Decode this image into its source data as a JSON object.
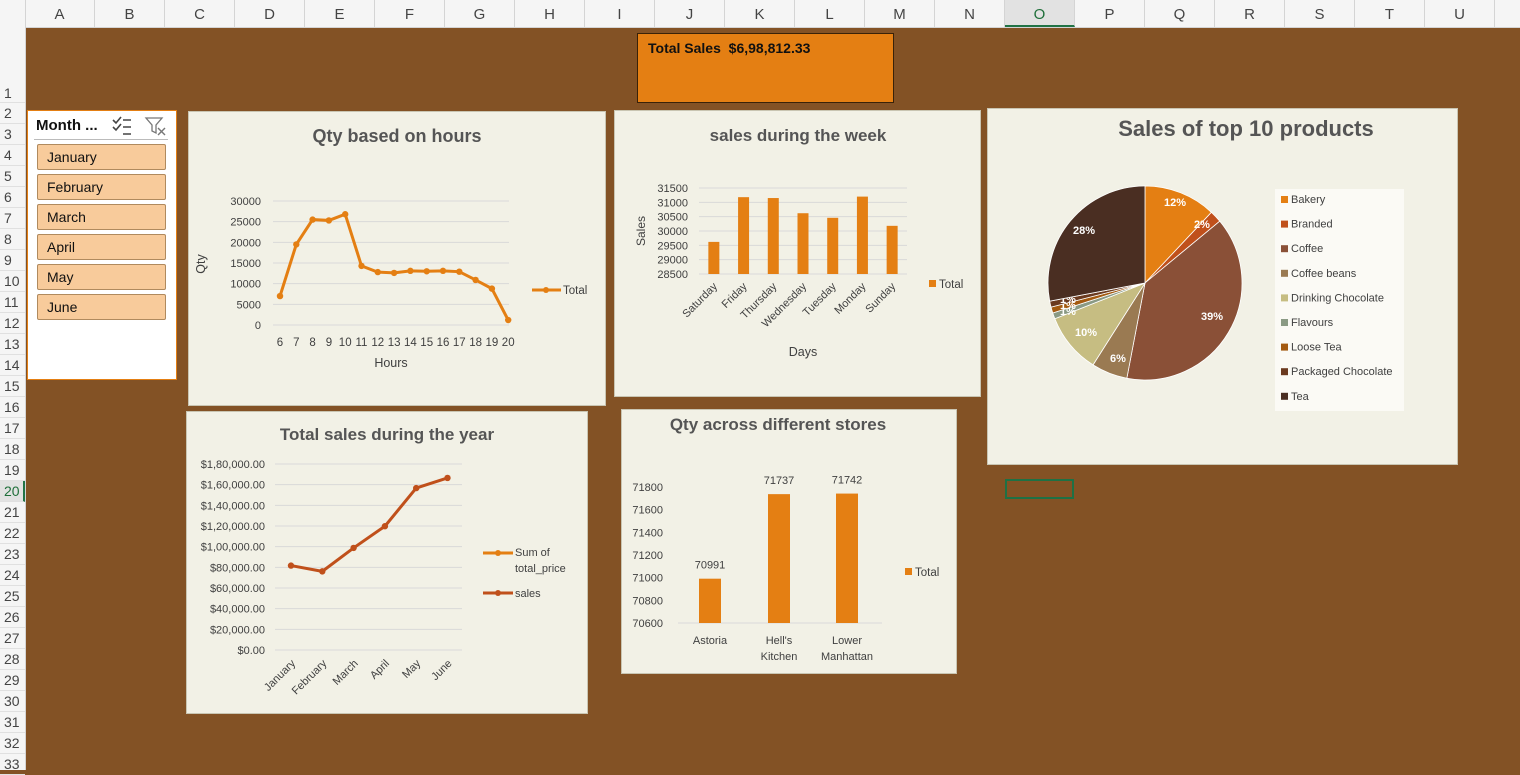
{
  "columns": [
    "A",
    "B",
    "C",
    "D",
    "E",
    "F",
    "G",
    "H",
    "I",
    "J",
    "K",
    "L",
    "M",
    "N",
    "O",
    "P",
    "Q",
    "R",
    "S",
    "T",
    "U"
  ],
  "rows": [
    "1",
    "2",
    "3",
    "4",
    "5",
    "6",
    "7",
    "8",
    "9",
    "10",
    "11",
    "12",
    "13",
    "14",
    "15",
    "16",
    "17",
    "18",
    "19",
    "20",
    "21",
    "22",
    "23",
    "24",
    "25",
    "26",
    "27",
    "28",
    "29",
    "30",
    "31",
    "32",
    "33"
  ],
  "selected_column": "O",
  "selected_row": "20",
  "kpi": {
    "label": "Total Sales",
    "value": "$6,98,812.33"
  },
  "slicer": {
    "title": "Month ...",
    "items": [
      "January",
      "February",
      "March",
      "April",
      "May",
      "June"
    ]
  },
  "colors": {
    "sheet_bg": "#835225",
    "orange": "#e47f13",
    "rust": "#c0501b",
    "chart_bg": "#f2f1e6"
  },
  "chart_data": [
    {
      "id": "hours",
      "type": "line",
      "title": "Qty based on hours",
      "xlabel": "Hours",
      "ylabel": "Qty",
      "x": [
        6,
        7,
        8,
        9,
        10,
        11,
        12,
        13,
        14,
        15,
        16,
        17,
        18,
        19,
        20
      ],
      "series": [
        {
          "name": "Total",
          "values": [
            7000,
            19500,
            25500,
            25300,
            26800,
            14300,
            12800,
            12600,
            13100,
            13000,
            13100,
            12900,
            10900,
            8800,
            1200
          ]
        }
      ],
      "ylim": [
        0,
        30000
      ],
      "yticks": [
        "0",
        "5000",
        "10000",
        "15000",
        "20000",
        "25000",
        "30000"
      ],
      "legend": "right",
      "grid": true
    },
    {
      "id": "week",
      "type": "bar",
      "title": "sales during the week",
      "xlabel": "Days",
      "ylabel": "Sales",
      "categories": [
        "Saturday",
        "Friday",
        "Thursday",
        "Wednesday",
        "Tuesday",
        "Monday",
        "Sunday"
      ],
      "series": [
        {
          "name": "Total",
          "values": [
            29620,
            31180,
            31150,
            30620,
            30460,
            31200,
            30180
          ]
        }
      ],
      "ylim": [
        28500,
        31500
      ],
      "yticks": [
        "28500",
        "29000",
        "29500",
        "30000",
        "30500",
        "31000",
        "31500"
      ],
      "legend": "right",
      "grid": true
    },
    {
      "id": "products",
      "type": "pie",
      "title": "Sales of top 10 products",
      "categories": [
        "Bakery",
        "Branded",
        "Coffee",
        "Coffee beans",
        "Drinking Chocolate",
        "Flavours",
        "Loose Tea",
        "Packaged Chocolate",
        "Tea"
      ],
      "values": [
        12,
        2,
        39,
        6,
        10,
        1,
        1,
        1,
        28
      ],
      "labels": [
        "12%",
        "2%",
        "39%",
        "6%",
        "10%",
        "1%",
        "1%",
        "1%",
        "28%"
      ],
      "colors": [
        "#e47f13",
        "#c0501b",
        "#8a5037",
        "#9a7a52",
        "#c6bd82",
        "#8a9a84",
        "#a45a10",
        "#6b3a1f",
        "#4a2e22"
      ],
      "legend": "right"
    },
    {
      "id": "year",
      "type": "line",
      "title": "Total sales during the year",
      "categories": [
        "January",
        "February",
        "March",
        "April",
        "May",
        "June"
      ],
      "series": [
        {
          "name": "Sum of total_price",
          "values": [
            81700,
            76100,
            98800,
            119800,
            156700,
            166500
          ]
        },
        {
          "name": "sales",
          "values": [
            81700,
            76100,
            98800,
            119800,
            156700,
            166500
          ]
        }
      ],
      "ylim": [
        0,
        180000
      ],
      "yticks": [
        "$0.00",
        "$20,000.00",
        "$40,000.00",
        "$60,000.00",
        "$80,000.00",
        "$1,00,000.00",
        "$1,20,000.00",
        "$1,40,000.00",
        "$1,60,000.00",
        "$1,80,000.00"
      ],
      "legend": "right",
      "grid": true
    },
    {
      "id": "stores",
      "type": "bar",
      "title": "Qty across different stores",
      "categories": [
        [
          "Astoria"
        ],
        [
          "Hell's",
          "Kitchen"
        ],
        [
          "Lower",
          "Manhattan"
        ]
      ],
      "series": [
        {
          "name": "Total",
          "values": [
            70991,
            71737,
            71742
          ]
        }
      ],
      "data_labels": [
        "70991",
        "71737",
        "71742"
      ],
      "ylim": [
        70600,
        71800
      ],
      "yticks": [
        "70600",
        "70800",
        "71000",
        "71200",
        "71400",
        "71600",
        "71800"
      ],
      "legend": "right",
      "grid": false
    }
  ]
}
